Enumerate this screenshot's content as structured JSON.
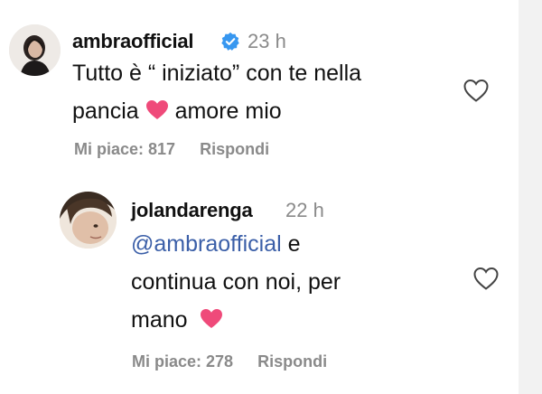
{
  "comments": [
    {
      "username": "ambraofficial",
      "verified": true,
      "time": "23 h",
      "text_parts": [
        "Tutto è “ iniziato” con te nella",
        "pancia",
        "amore mio"
      ],
      "likes_label": "Mi piace: 817",
      "reply_label": "Rispondi"
    },
    {
      "username": "jolandarenga",
      "verified": false,
      "time": "22 h",
      "mention": "@ambraofficial",
      "text_parts": [
        "e",
        "continua con noi, per",
        "mano"
      ],
      "likes_label": "Mi piace: 278",
      "reply_label": "Rispondi"
    }
  ],
  "colors": {
    "heart_emoji": "#ef4a7a",
    "verified": "#3797f0",
    "mention": "#3b5fa8",
    "secondary": "#8a8a8a"
  },
  "icons": {
    "like": "heart-outline-icon",
    "emoji": "pink-heart-emoji",
    "verified": "verified-badge-icon"
  }
}
